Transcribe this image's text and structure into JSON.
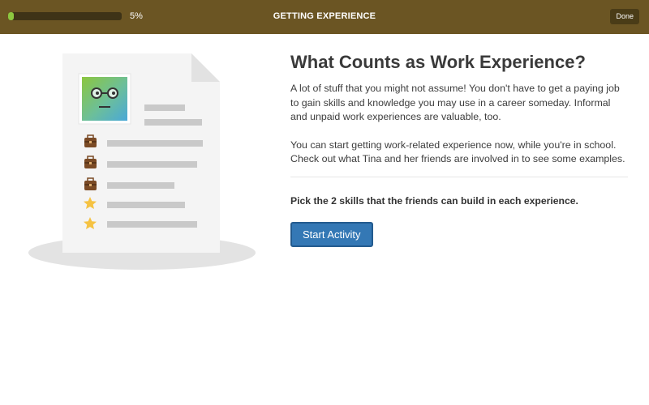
{
  "topbar": {
    "progress_fraction": 0.05,
    "progress_label": "5%",
    "title": "GETTING EXPERIENCE",
    "done_label": "Done"
  },
  "colors": {
    "topbar_bg": "#6b5523",
    "progress_fill": "#8cc63f",
    "button_blue": "#3478b5",
    "star_yellow": "#f5c242",
    "briefcase_brown": "#7a4a25"
  },
  "illustration": {
    "list_icons": [
      "briefcase-icon",
      "briefcase-icon",
      "briefcase-icon",
      "star-icon",
      "star-icon"
    ]
  },
  "main": {
    "heading": "What Counts as Work Experience?",
    "paragraph1": "A lot of stuff that you might not assume! You don't have to get a paying job to gain skills and knowledge you may use in a career someday. Informal and unpaid work experiences are valuable, too.",
    "paragraph2": "You can start getting work-related experience now, while you're in school. Check out what Tina and her friends are involved in to see some examples.",
    "instruction": "Pick the 2 skills that the friends can build in each experience.",
    "start_button_label": "Start Activity"
  }
}
